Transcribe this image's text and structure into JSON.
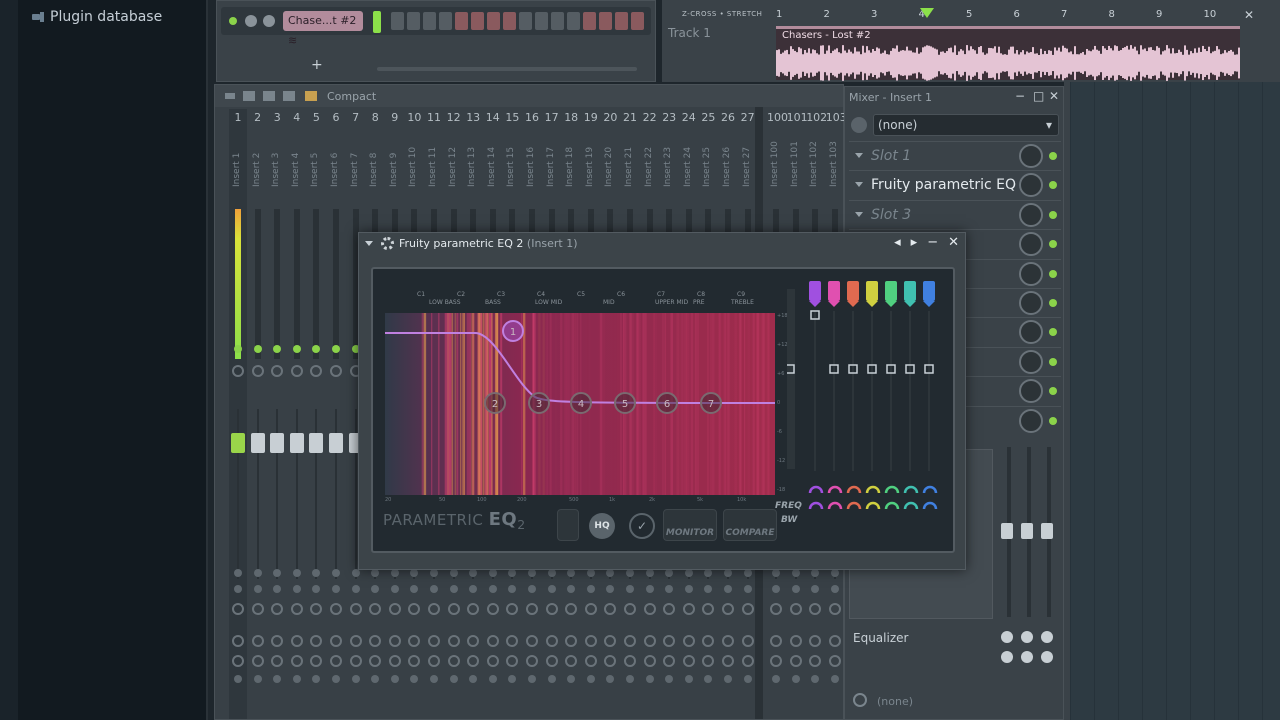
{
  "browser": {
    "item": "Plugin database"
  },
  "channel_rack": {
    "channel_name": "Chase...t #2"
  },
  "playlist": {
    "tools": "Z-CROSS • STRETCH",
    "track_label": "Track 1",
    "bars": [
      "1",
      "2",
      "3",
      "4",
      "5",
      "6",
      "7",
      "8",
      "9",
      "10"
    ],
    "clip_label": "Chasers - Lost #2"
  },
  "mixer": {
    "view_label": "Compact",
    "master_num": "1",
    "master_name": "Insert 1"
  },
  "insert_panel": {
    "title": "Mixer - Insert 1",
    "input": "(none)",
    "slots": [
      {
        "label": "Slot 1",
        "active": false
      },
      {
        "label": "Fruity parametric EQ 2",
        "active": true
      },
      {
        "label": "Slot 3",
        "active": false
      }
    ],
    "eq_section": "Equalizer",
    "output": "(none)"
  },
  "eq_plugin": {
    "title": "Fruity parametric EQ 2",
    "subtitle": "(Insert 1)",
    "brand_a": "PARAMETRIC",
    "brand_b": "EQ",
    "brand_c": "2",
    "hq_label": "HQ",
    "monitor_label": "MONITOR",
    "compare_label": "COMPARE",
    "freq_label": "FREQ",
    "bw_label": "BW",
    "band_notes": [
      "C1",
      "C2",
      "C3",
      "C4",
      "C5",
      "C6",
      "C7",
      "C8",
      "C9"
    ],
    "band_regions": [
      "LOW BASS",
      "BASS",
      "LOW MID",
      "MID",
      "UPPER MID",
      "PRE",
      "TREBLE"
    ],
    "freq_ticks": [
      "20",
      "50",
      "100",
      "200",
      "500",
      "1k",
      "2k",
      "5k",
      "10k"
    ],
    "gain_ticks": [
      "+18",
      "+12",
      "+6",
      "0",
      "-6",
      "-12",
      "-18"
    ],
    "band_numbers": [
      "1",
      "2",
      "3",
      "4",
      "5",
      "6",
      "7"
    ],
    "band_colors": [
      "#a050e0",
      "#e050b0",
      "#e06a50",
      "#d0d040",
      "#50d080",
      "#40c0b0",
      "#4080e0"
    ]
  }
}
